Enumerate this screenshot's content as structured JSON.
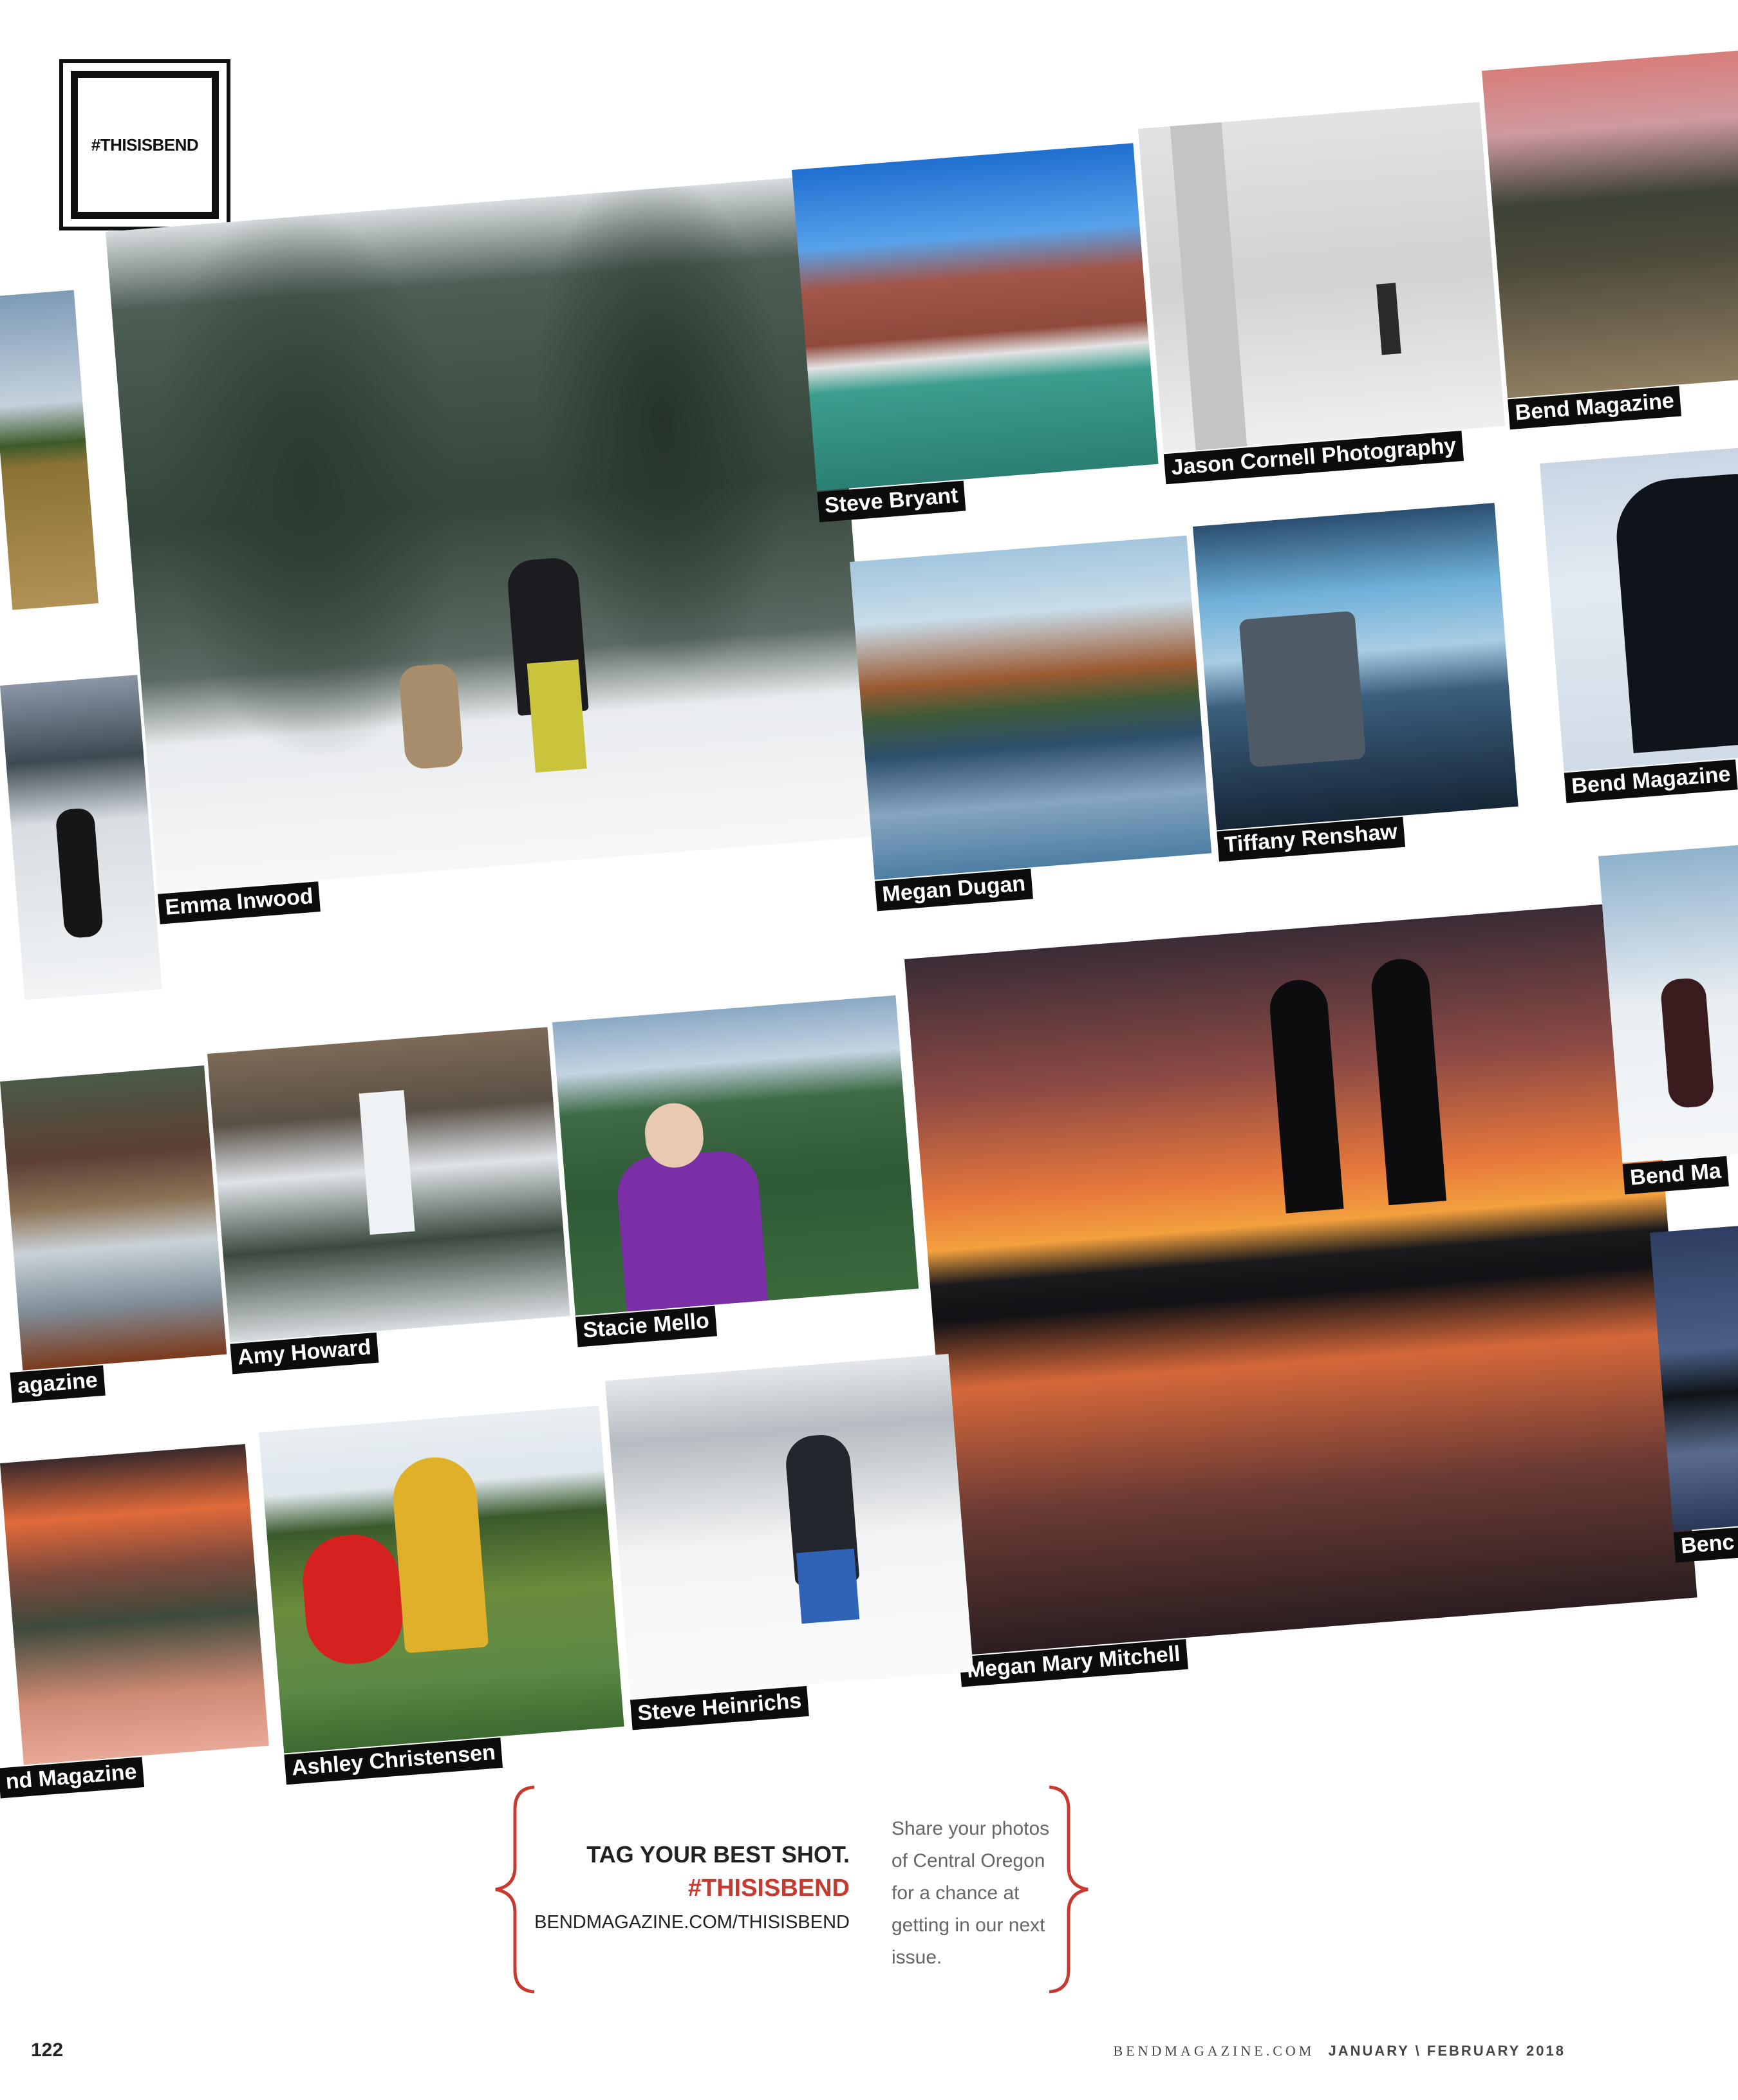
{
  "header": {
    "logo_text": "#THISISBEND"
  },
  "photos": [
    {
      "credit": ""
    },
    {
      "credit": "Emma Inwood"
    },
    {
      "credit": "Steve Bryant"
    },
    {
      "credit": "Jason Cornell Photography"
    },
    {
      "credit": "Bend Magazine"
    },
    {
      "credit": ""
    },
    {
      "credit": "Megan Dugan"
    },
    {
      "credit": "Tiffany Renshaw"
    },
    {
      "credit": "Bend Magazine"
    },
    {
      "credit": "agazine"
    },
    {
      "credit": "Amy Howard"
    },
    {
      "credit": "Stacie Mello"
    },
    {
      "credit": "Megan Mary Mitchell"
    },
    {
      "credit": "Bend Ma"
    },
    {
      "credit": "nd Magazine"
    },
    {
      "credit": "Ashley Christensen"
    },
    {
      "credit": "Steve Heinrichs"
    },
    {
      "credit": "Benc"
    }
  ],
  "cta": {
    "tag_line": "TAG YOUR BEST SHOT.",
    "hashtag": "#THISISBEND",
    "url": "BENDMAGAZINE.COM/THISISBEND",
    "share_text": "Share your photos of Central Oregon for a chance at getting in our next issue."
  },
  "footer": {
    "page_number": "122",
    "site": "BENDMAGAZINE.COM",
    "issue": "JANUARY \\ FEBRUARY 2018"
  }
}
